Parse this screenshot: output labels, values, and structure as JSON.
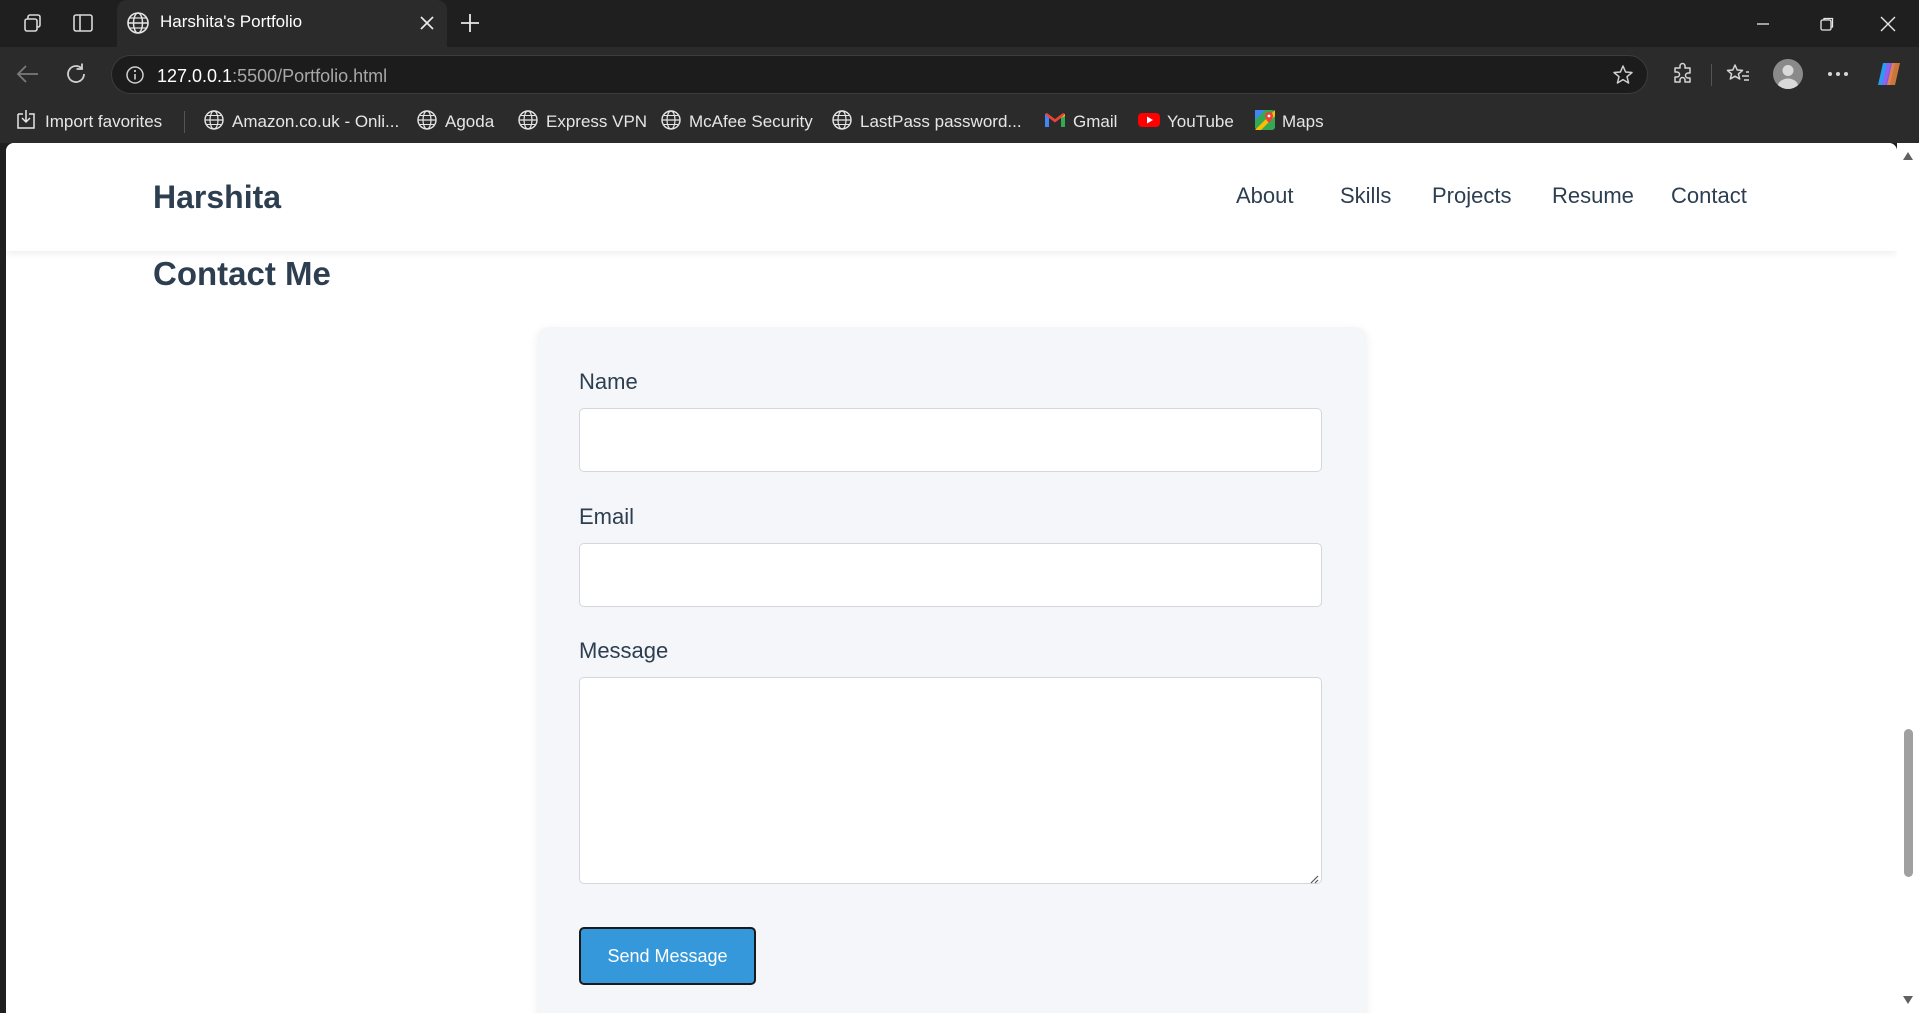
{
  "browser": {
    "tab": {
      "title": "Harshita's Portfolio"
    },
    "address": {
      "host": "127.0.0.1",
      "path": ":5500/Portfolio.html"
    },
    "bookmarks": [
      {
        "label": "Import favorites",
        "icon": "import-icon"
      },
      {
        "label": "Amazon.co.uk - Onli...",
        "icon": "globe-icon"
      },
      {
        "label": "Agoda",
        "icon": "globe-icon"
      },
      {
        "label": "Express VPN",
        "icon": "globe-icon"
      },
      {
        "label": "McAfee Security",
        "icon": "globe-icon"
      },
      {
        "label": "LastPass password...",
        "icon": "globe-icon"
      },
      {
        "label": "Gmail",
        "icon": "gmail-icon"
      },
      {
        "label": "YouTube",
        "icon": "youtube-icon"
      },
      {
        "label": "Maps",
        "icon": "maps-icon"
      }
    ]
  },
  "site": {
    "brand": "Harshita",
    "nav": [
      "About",
      "Skills",
      "Projects",
      "Resume",
      "Contact"
    ],
    "contact": {
      "title": "Contact Me",
      "name_label": "Name",
      "name_value": "",
      "email_label": "Email",
      "email_value": "",
      "message_label": "Message",
      "message_value": "",
      "submit_label": "Send Message"
    }
  },
  "colors": {
    "heading": "#2c3e50",
    "button": "#3498db",
    "card": "#f4f6f9"
  }
}
